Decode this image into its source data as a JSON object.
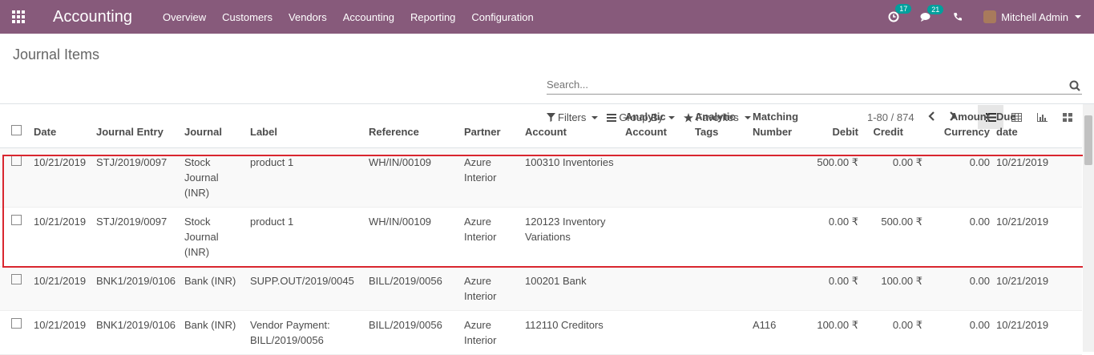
{
  "navbar": {
    "brand": "Accounting",
    "menu": [
      "Overview",
      "Customers",
      "Vendors",
      "Accounting",
      "Reporting",
      "Configuration"
    ],
    "activities_count": "17",
    "messages_count": "21",
    "user_name": "Mitchell Admin"
  },
  "control": {
    "title": "Journal Items",
    "search_placeholder": "Search...",
    "filters_label": "Filters",
    "groupby_label": "Group By",
    "favorites_label": "Favorites",
    "pager": "1-80 / 874"
  },
  "table": {
    "headers": [
      [
        "Date"
      ],
      [
        "Journal Entry"
      ],
      [
        "Journal"
      ],
      [
        "Label"
      ],
      [
        "Reference"
      ],
      [
        "Partner"
      ],
      [
        "Account"
      ],
      [
        "Analytic",
        "Account"
      ],
      [
        "Analytic",
        "Tags"
      ],
      [
        "Matching",
        "Number"
      ],
      [
        "Debit"
      ],
      [
        "Credit"
      ],
      [
        "Amount",
        "Currency"
      ],
      [
        "Due",
        "date"
      ]
    ],
    "rows": [
      {
        "date": "10/21/2019",
        "entry": "STJ/2019/0097",
        "journal": "Stock Journal (INR)",
        "label": "product 1",
        "reference": "WH/IN/00109",
        "partner": "Azure Interior",
        "account": "100310 Inventories",
        "analytic_account": "",
        "analytic_tags": "",
        "matching": "",
        "debit": "500.00 ₹",
        "credit": "0.00 ₹",
        "amount_currency": "0.00",
        "due": "10/21/2019"
      },
      {
        "date": "10/21/2019",
        "entry": "STJ/2019/0097",
        "journal": "Stock Journal (INR)",
        "label": "product 1",
        "reference": "WH/IN/00109",
        "partner": "Azure Interior",
        "account": "120123 Inventory Variations",
        "analytic_account": "",
        "analytic_tags": "",
        "matching": "",
        "debit": "0.00 ₹",
        "credit": "500.00 ₹",
        "amount_currency": "0.00",
        "due": "10/21/2019"
      },
      {
        "date": "10/21/2019",
        "entry": "BNK1/2019/0106",
        "journal": "Bank (INR)",
        "label": "SUPP.OUT/2019/0045",
        "reference": "BILL/2019/0056",
        "partner": "Azure Interior",
        "account": "100201 Bank",
        "analytic_account": "",
        "analytic_tags": "",
        "matching": "",
        "debit": "0.00 ₹",
        "credit": "100.00 ₹",
        "amount_currency": "0.00",
        "due": "10/21/2019"
      },
      {
        "date": "10/21/2019",
        "entry": "BNK1/2019/0106",
        "journal": "Bank (INR)",
        "label": "Vendor Payment: BILL/2019/0056",
        "reference": "BILL/2019/0056",
        "partner": "Azure Interior",
        "account": "112110 Creditors",
        "analytic_account": "",
        "analytic_tags": "",
        "matching": "A116",
        "debit": "100.00 ₹",
        "credit": "0.00 ₹",
        "amount_currency": "0.00",
        "due": "10/21/2019"
      }
    ]
  },
  "colors": {
    "brand": "#875a7b",
    "highlight": "#d9262f",
    "badge": "#00a09d"
  }
}
